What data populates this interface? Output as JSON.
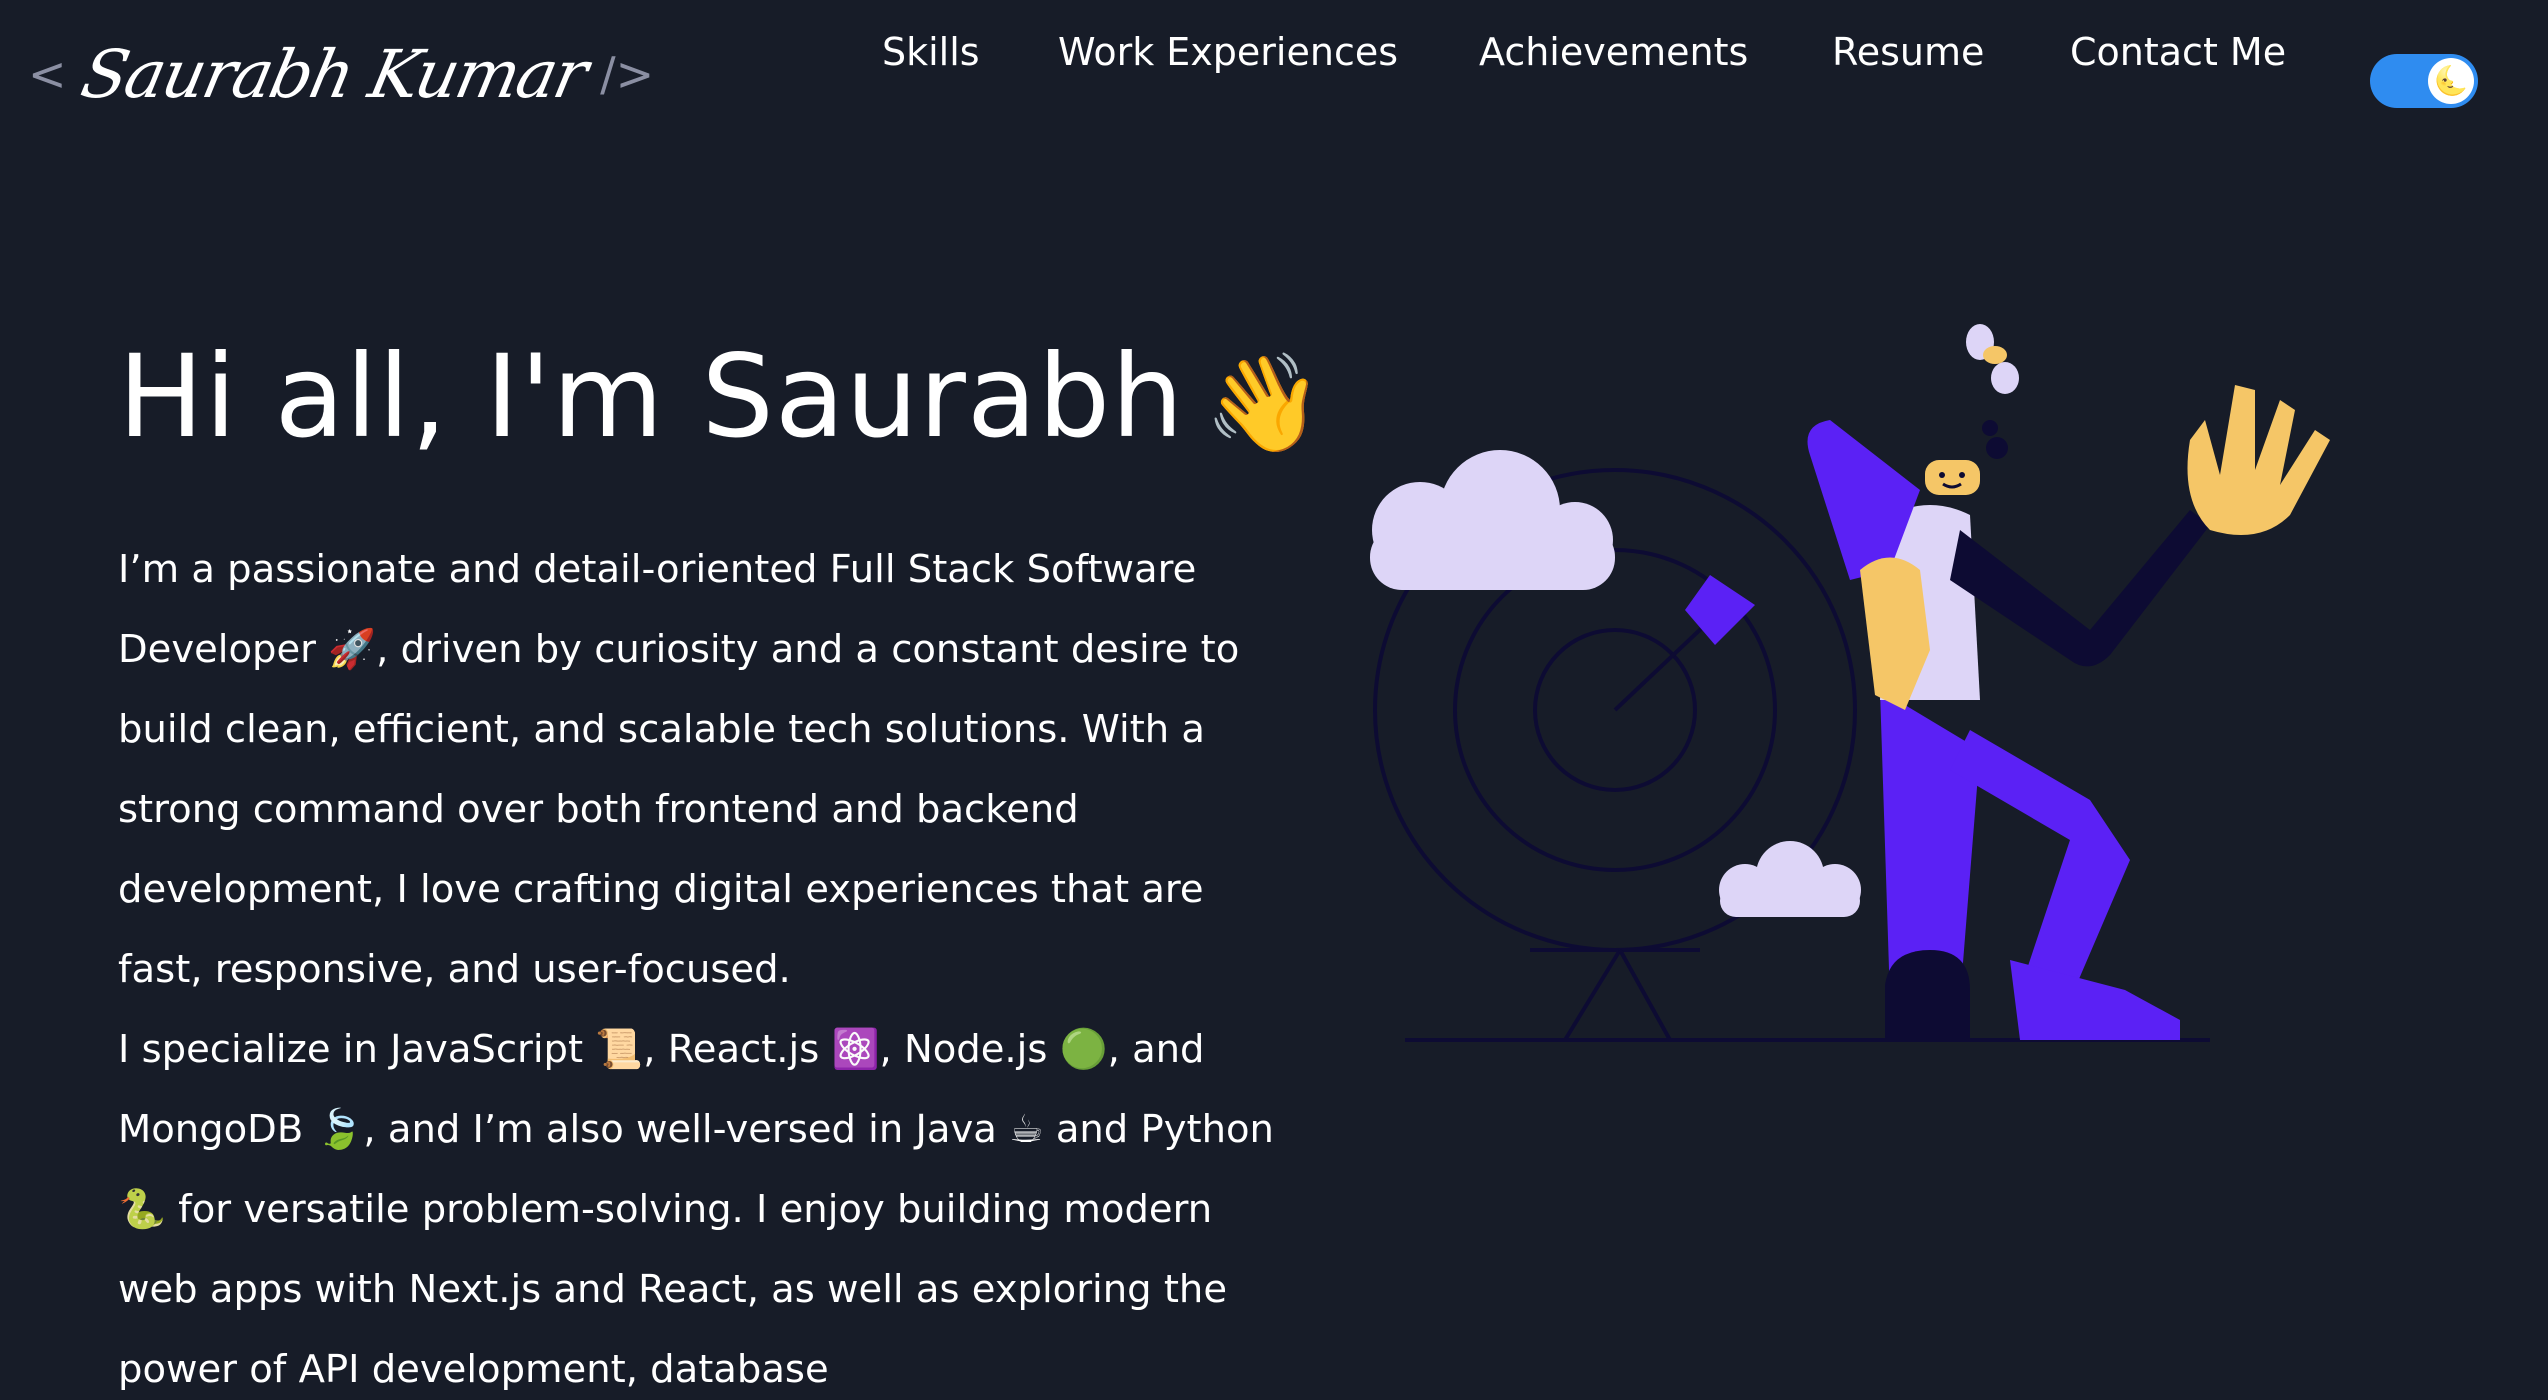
{
  "logo": {
    "open_bracket": "<",
    "name": "Saurabh Kumar",
    "close_bracket": "/>"
  },
  "nav": {
    "items": [
      {
        "label": "Skills"
      },
      {
        "label": "Work Experiences"
      },
      {
        "label": "Achievements"
      },
      {
        "label": "Resume"
      },
      {
        "label": "Contact Me"
      }
    ]
  },
  "theme_toggle": {
    "state": "dark",
    "knob_icon": "moon-icon",
    "glyph": "🌜"
  },
  "hero": {
    "greeting": "Hi all, I'm Saurabh",
    "greeting_emoji": "👋",
    "paragraph_1": "I’m a passionate and detail-oriented Full Stack Software Developer 🚀, driven by curiosity and a constant desire to build clean, efficient, and scalable tech solutions. With a strong command over both frontend and backend development, I love crafting digital experiences that are fast, responsive, and user-focused.",
    "paragraph_2": "I specialize in JavaScript 📜, React.js ⚛️, Node.js 🟢, and MongoDB 🍃, and I’m also well-versed in Java ☕ and Python 🐍 for versatile problem-solving. I enjoy building modern web apps with Next.js and React, as well as exploring the power of API development, database"
  },
  "colors": {
    "background": "#171c28",
    "text": "#ffffff",
    "toggle": "#2f8cf0",
    "accent_purple": "#5b21f5",
    "cloud": "#ddd5f7",
    "skin": "#f5c667",
    "dark_navy": "#0d0b33"
  }
}
